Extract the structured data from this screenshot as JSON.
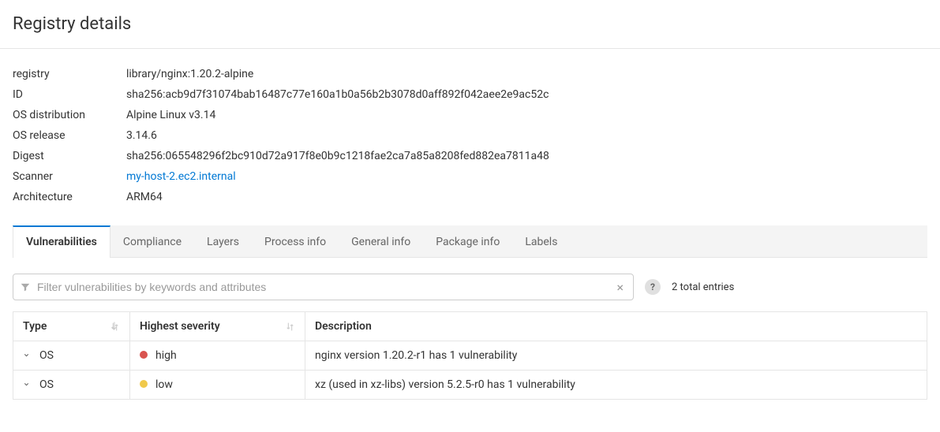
{
  "header": {
    "title": "Registry details"
  },
  "details": {
    "registry_label": "registry",
    "registry_value": "library/nginx:1.20.2-alpine",
    "id_label": "ID",
    "id_value": "sha256:acb9d7f31074bab16487c77e160a1b0a56b2b3078d0aff892f042aee2e9ac52c",
    "os_dist_label": "OS distribution",
    "os_dist_value": "Alpine Linux v3.14",
    "os_release_label": "OS release",
    "os_release_value": "3.14.6",
    "digest_label": "Digest",
    "digest_value": "sha256:065548296f2bc910d72a917f8e0b9c1218fae2ca7a85a8208fed882ea7811a48",
    "scanner_label": "Scanner",
    "scanner_value": "my-host-2.ec2.internal",
    "arch_label": "Architecture",
    "arch_value": "ARM64"
  },
  "tabs": [
    {
      "label": "Vulnerabilities",
      "active": true
    },
    {
      "label": "Compliance",
      "active": false
    },
    {
      "label": "Layers",
      "active": false
    },
    {
      "label": "Process info",
      "active": false
    },
    {
      "label": "General info",
      "active": false
    },
    {
      "label": "Package info",
      "active": false
    },
    {
      "label": "Labels",
      "active": false
    }
  ],
  "filter": {
    "placeholder": "Filter vulnerabilities by keywords and attributes",
    "help": "?",
    "entries_text": "2 total entries",
    "clear": "×"
  },
  "table": {
    "headers": {
      "type": "Type",
      "severity": "Highest severity",
      "description": "Description"
    },
    "rows": [
      {
        "type": "OS",
        "severity": "high",
        "severity_class": "sev-high",
        "description": "nginx version 1.20.2-r1 has 1 vulnerability"
      },
      {
        "type": "OS",
        "severity": "low",
        "severity_class": "sev-low",
        "description": "xz (used in xz-libs) version 5.2.5-r0 has 1 vulnerability"
      }
    ]
  }
}
